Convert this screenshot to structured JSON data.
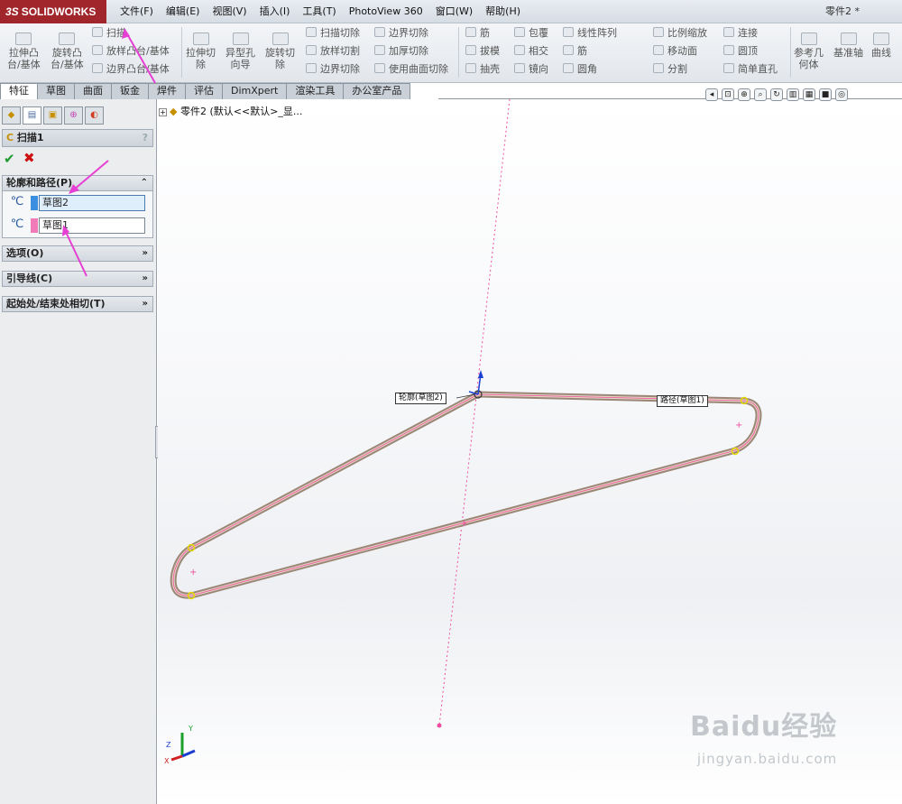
{
  "app": {
    "logo_prefix": "3S",
    "logo_text": "SOLIDWORKS",
    "window_title": "零件2 *"
  },
  "menu": [
    "文件(F)",
    "编辑(E)",
    "视图(V)",
    "插入(I)",
    "工具(T)",
    "PhotoView 360",
    "窗口(W)",
    "帮助(H)"
  ],
  "toolbar": {
    "extrude_boss": "拉伸凸\n台/基体",
    "revolve_boss": "旋转凸\n台/基体",
    "sweep": "扫描",
    "loft_boss": "放样凸台/基体",
    "boundary_boss": "边界凸台/基体",
    "extrude_cut": "拉伸切\n除",
    "hole_wizard": "异型孔\n向导",
    "revolve_cut": "旋转切\n除",
    "sweep_cut": "扫描切除",
    "loft_cut": "放样切割",
    "boundary_cut": "边界切除",
    "boundary_cut2": "边界切除",
    "thicken_cut": "加厚切除",
    "surface_cut": "使用曲面切除",
    "rib": "筋",
    "draft": "拔模",
    "shell": "抽壳",
    "wrap": "包覆",
    "intersect": "相交",
    "mirror": "镜向",
    "linear_pattern": "线性阵列",
    "rib2": "筋",
    "fillet": "圆角",
    "scale": "比例缩放",
    "move_face": "移动面",
    "split": "分割",
    "connect": "连接",
    "dome": "圆顶",
    "simple_hole": "简单直孔",
    "ref_geometry": "参考几\n何体",
    "ref_axis": "基准轴",
    "curves": "曲线"
  },
  "tabs": [
    "特征",
    "草图",
    "曲面",
    "钣金",
    "焊件",
    "评估",
    "DimXpert",
    "渲染工具",
    "办公室产品"
  ],
  "feature_tree": {
    "expander": "+",
    "root_text": "零件2  (默认<<默认>_显..."
  },
  "property_manager": {
    "title": "扫描1",
    "help": "?",
    "ok_symbol": "✔",
    "cancel_symbol": "✖",
    "groups": {
      "profile_path": "轮廓和路径(P)",
      "options": "选项(O)",
      "guide_curves": "引导线(C)",
      "tangency": "起始处/结束处相切(T)"
    },
    "profile_value": "草图2",
    "path_value": "草图1",
    "expand_symbol": "«",
    "collapse_symbol": "»"
  },
  "viewport": {
    "profile_label": "轮廓(草图2)",
    "path_label": "路径(草图1)",
    "triad": {
      "x": "X",
      "y": "Y",
      "z": "Z"
    }
  },
  "colors": {
    "brand": "#a0262c",
    "sweep_body": "#d9c4b0",
    "sweep_edge": "#9a8778",
    "highlight": "#ffff66",
    "sketch_pink": "#ee4fa0",
    "accent_arrow": "#e63fd4"
  },
  "watermark": {
    "main": "Baidu经验",
    "sub": "jingyan.baidu.com"
  }
}
